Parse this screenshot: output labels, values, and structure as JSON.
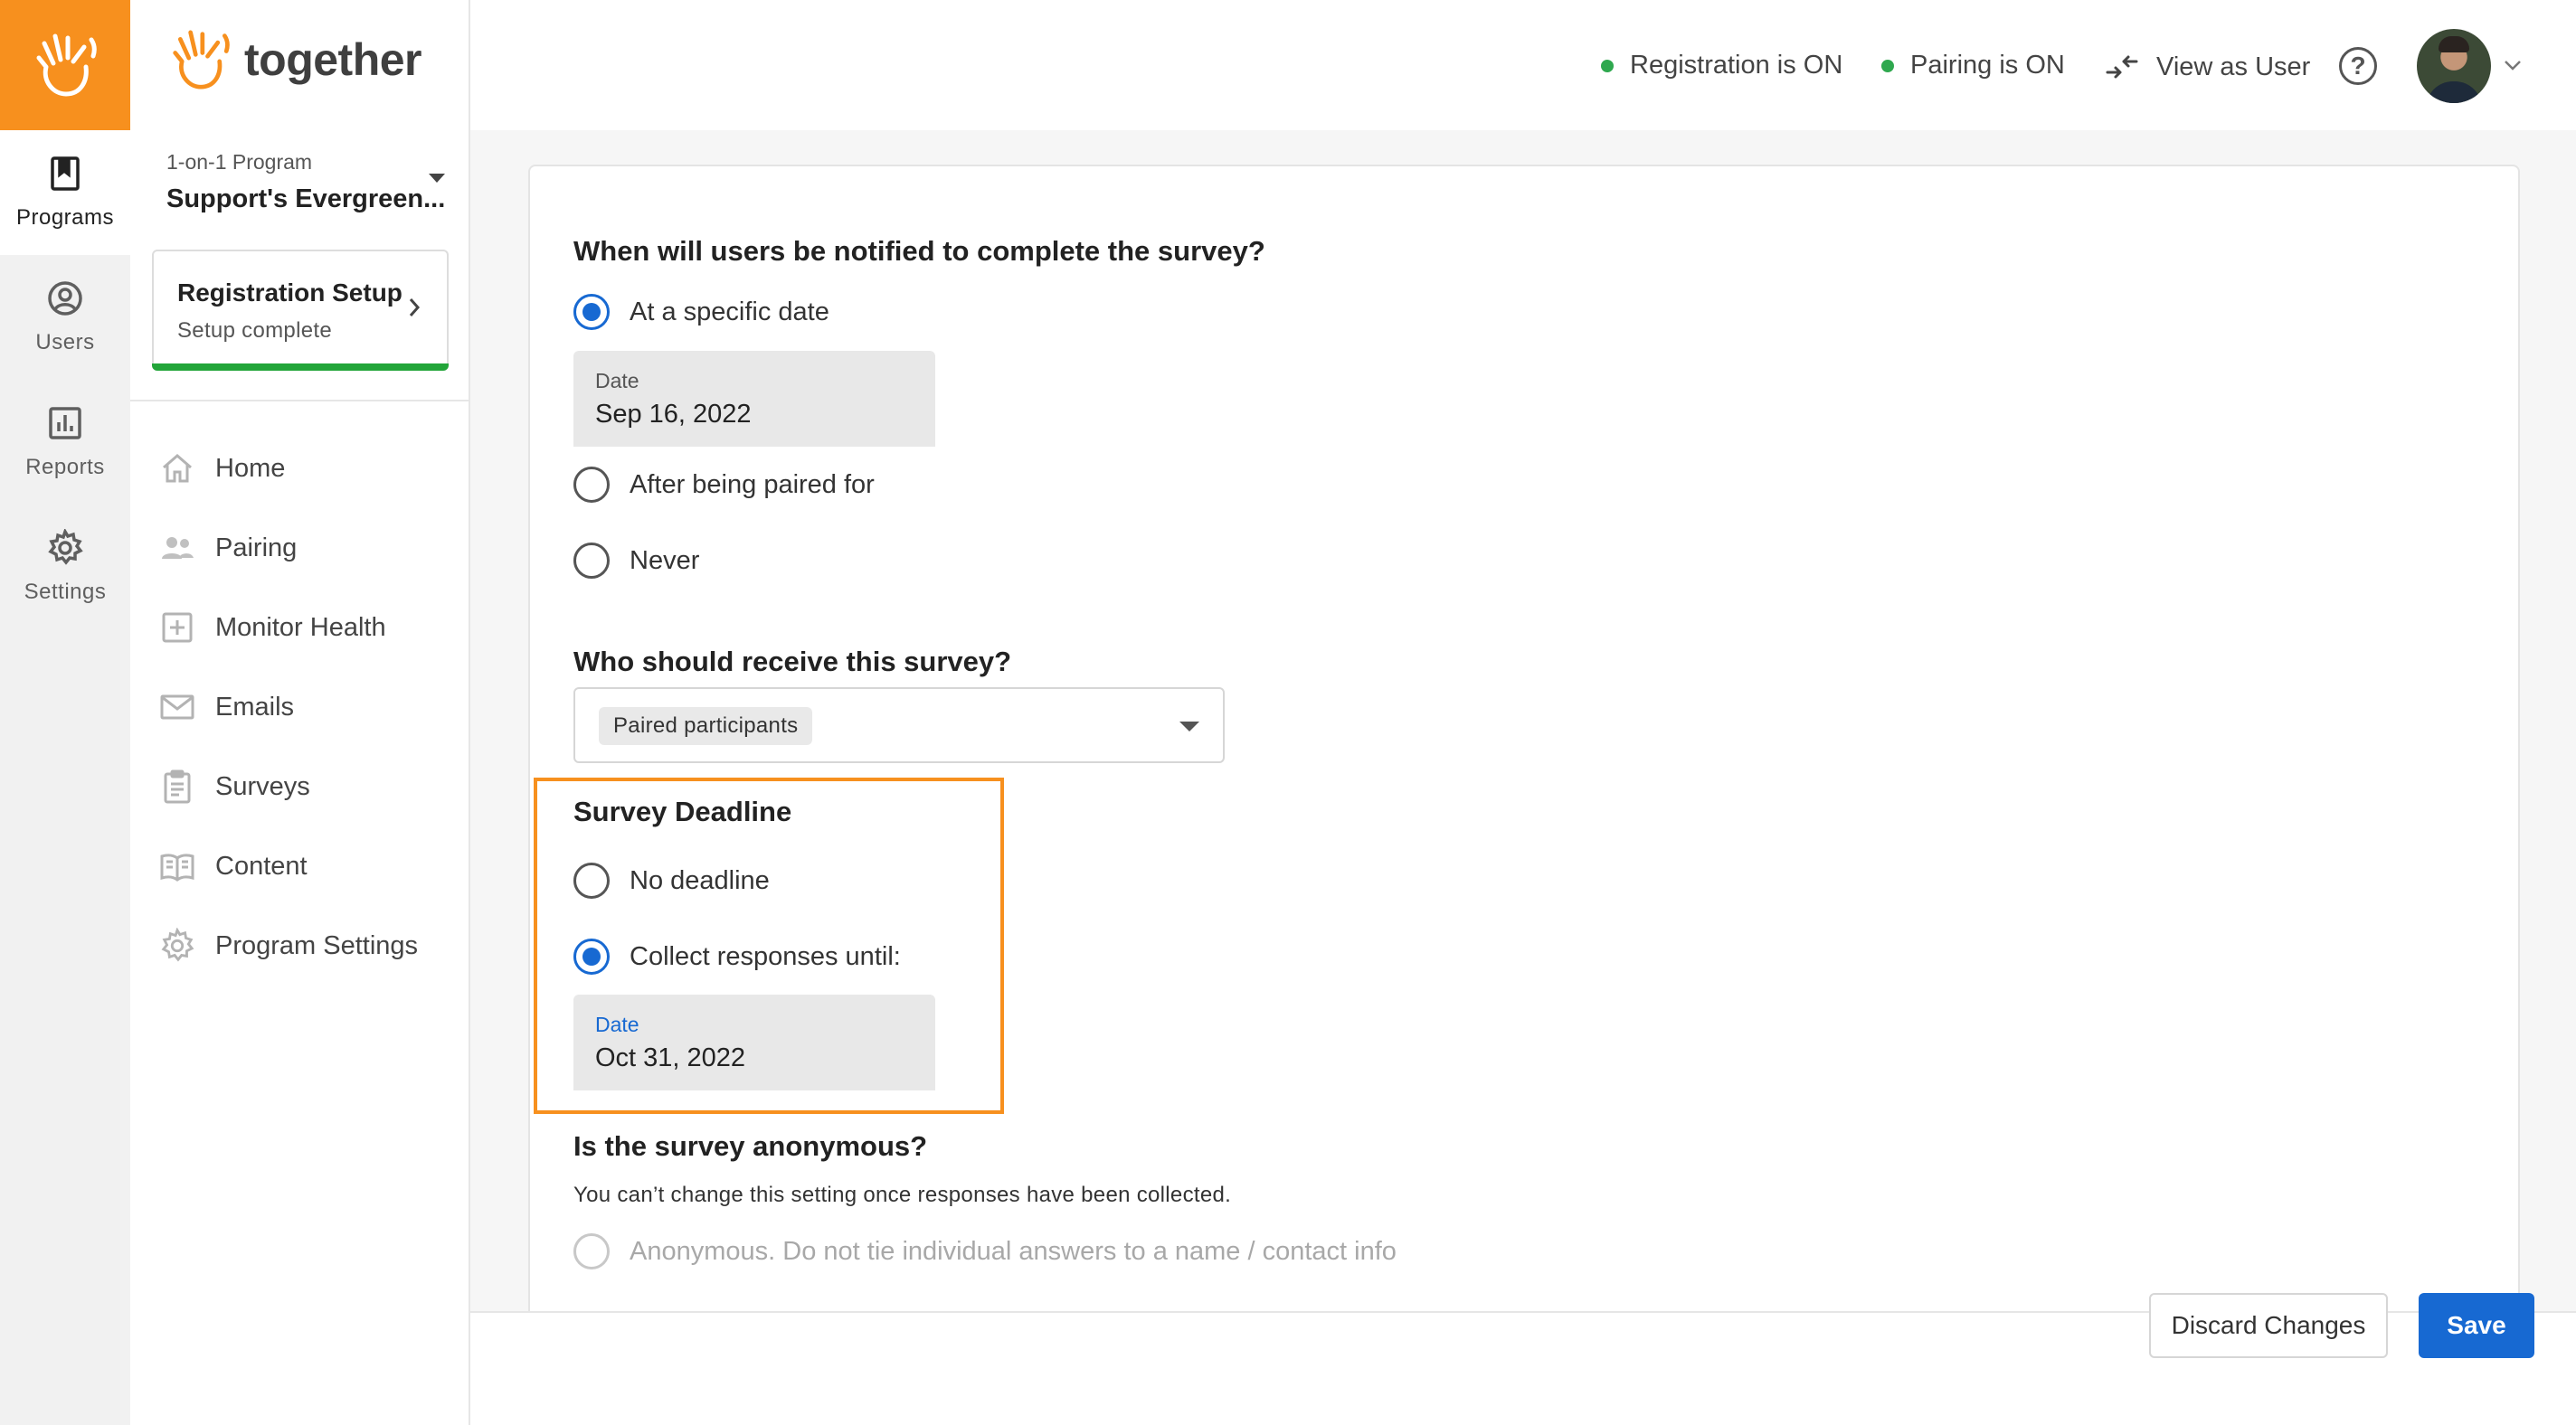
{
  "rail": {
    "items": [
      {
        "label": "Programs",
        "icon": "bookmark-icon",
        "active": true
      },
      {
        "label": "Users",
        "icon": "user-circle-icon"
      },
      {
        "label": "Reports",
        "icon": "bar-chart-icon"
      },
      {
        "label": "Settings",
        "icon": "gear-icon"
      }
    ]
  },
  "brand": {
    "name": "together",
    "accent": "#f7901e"
  },
  "program": {
    "type": "1-on-1 Program",
    "name": "Support's Evergreen..."
  },
  "setup_card": {
    "title": "Registration Setup",
    "subtitle": "Setup complete",
    "progress_color": "#22a539"
  },
  "sidebar": {
    "items": [
      {
        "label": "Home",
        "icon": "home-icon"
      },
      {
        "label": "Pairing",
        "icon": "people-icon"
      },
      {
        "label": "Monitor Health",
        "icon": "plus-square-icon"
      },
      {
        "label": "Emails",
        "icon": "envelope-icon"
      },
      {
        "label": "Surveys",
        "icon": "clipboard-icon"
      },
      {
        "label": "Content",
        "icon": "book-open-icon"
      },
      {
        "label": "Program Settings",
        "icon": "gear-icon"
      }
    ]
  },
  "header": {
    "registration_status": "Registration is ON",
    "pairing_status": "Pairing is ON",
    "view_as_user": "View as User",
    "help_glyph": "?",
    "status_color": "#2fa84f"
  },
  "form": {
    "notify": {
      "question": "When will users be notified to complete the survey?",
      "options": [
        "At a specific date",
        "After being paired for",
        "Never"
      ],
      "selected": "At a specific date",
      "date_label": "Date",
      "date_value": "Sep 16, 2022"
    },
    "recipients": {
      "question": "Who should receive this survey?",
      "selected_chip": "Paired participants"
    },
    "deadline": {
      "title": "Survey Deadline",
      "options": [
        "No deadline",
        "Collect responses until:"
      ],
      "selected": "Collect responses until:",
      "date_label": "Date",
      "date_value": "Oct 31, 2022",
      "highlight_color": "#f7901e"
    },
    "anonymous": {
      "question": "Is the survey anonymous?",
      "note": "You can’t change this setting once responses have been collected.",
      "option": "Anonymous. Do not tie individual answers to a name / contact info"
    }
  },
  "footer": {
    "discard_label": "Discard Changes",
    "save_label": "Save",
    "primary_color": "#1769d2"
  }
}
